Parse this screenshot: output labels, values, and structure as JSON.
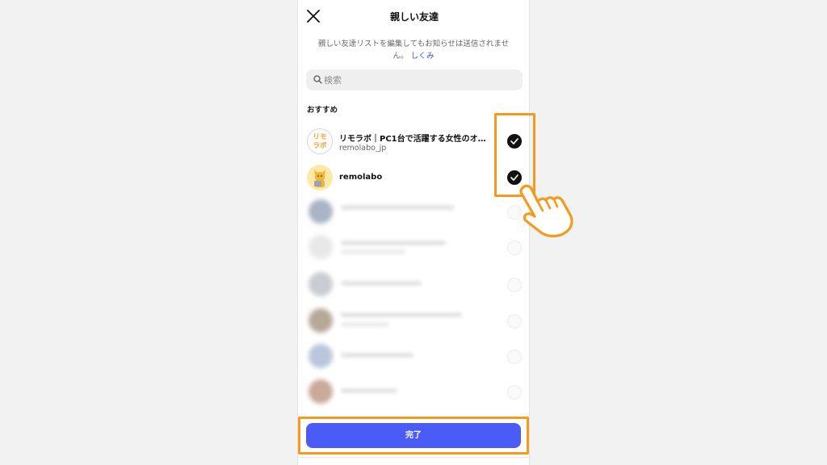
{
  "header": {
    "title": "親しい友達"
  },
  "notice": {
    "text": "親しい友達リストを編集してもお知らせは送信されません。",
    "link": "しくみ"
  },
  "search": {
    "placeholder": "検索",
    "value": ""
  },
  "section": {
    "label": "おすすめ"
  },
  "recommended": [
    {
      "name": "リモラボ｜PC1台で活躍する女性のオン…",
      "handle": "remolabo_jp",
      "avatar_text_top": "リモ",
      "avatar_text_bottom": "ラボ",
      "checked": true
    },
    {
      "name": "remolabo",
      "handle": "",
      "checked": true
    }
  ],
  "done_button": {
    "label": "完了"
  },
  "colors": {
    "accent": "#4a5cf5",
    "highlight": "#f59a1b",
    "link": "#3d4fd6"
  },
  "icons": {
    "close": "close-icon",
    "search": "search-icon",
    "check": "check-icon",
    "pointer": "pointing-hand-icon"
  }
}
